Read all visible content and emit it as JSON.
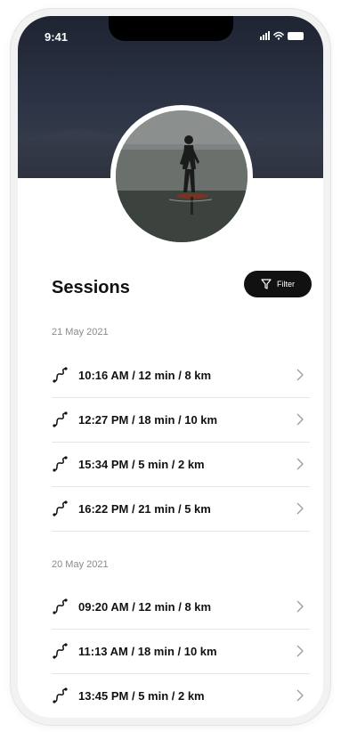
{
  "status_bar": {
    "time": "9:41"
  },
  "header": {
    "title": "Sessions",
    "filter_label": "Filter"
  },
  "groups": [
    {
      "date": "21 May 2021",
      "sessions": [
        "10:16 AM / 12 min / 8 km",
        "12:27 PM / 18 min / 10 km",
        "15:34 PM / 5 min / 2 km",
        "16:22 PM / 21 min / 5 km"
      ]
    },
    {
      "date": "20 May 2021",
      "sessions": [
        "09:20 AM / 12 min / 8 km",
        "11:13 AM / 18 min / 10 km",
        "13:45 PM / 5 min / 2 km"
      ]
    }
  ],
  "icons": {
    "row_icon": "route-icon",
    "row_chevron": "chevron-right-icon",
    "filter_icon": "filter-icon"
  }
}
